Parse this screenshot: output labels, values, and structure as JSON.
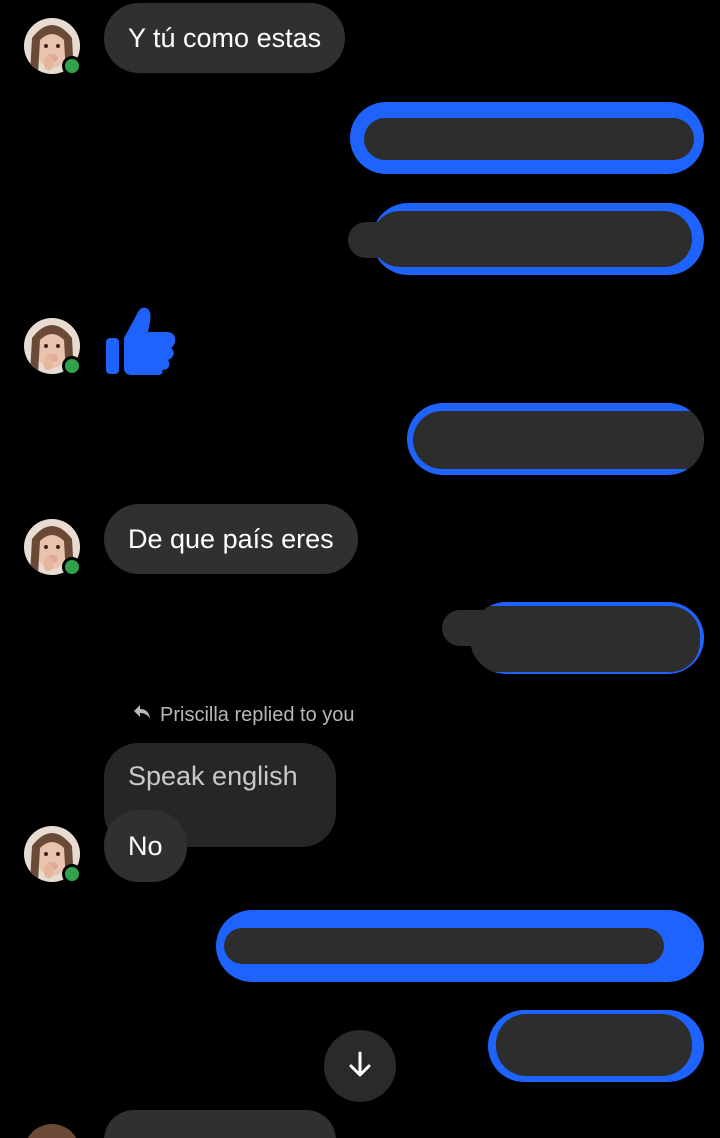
{
  "contact": {
    "name": "Priscilla",
    "online": true
  },
  "messages": {
    "m1": "Y tú como estas",
    "m2": "De que país eres",
    "quoted": "Speak english",
    "reply": "No"
  },
  "reply_indicator": {
    "text": "Priscilla replied to you",
    "icon": "reply-arrow-icon"
  },
  "reaction": {
    "icon": "thumbs-up-icon"
  },
  "scroll_button": {
    "icon": "arrow-down-icon"
  },
  "colors": {
    "outgoing_bubble": "#1f63ff",
    "incoming_bubble": "#303030",
    "online": "#31a24c",
    "background": "#000000"
  }
}
